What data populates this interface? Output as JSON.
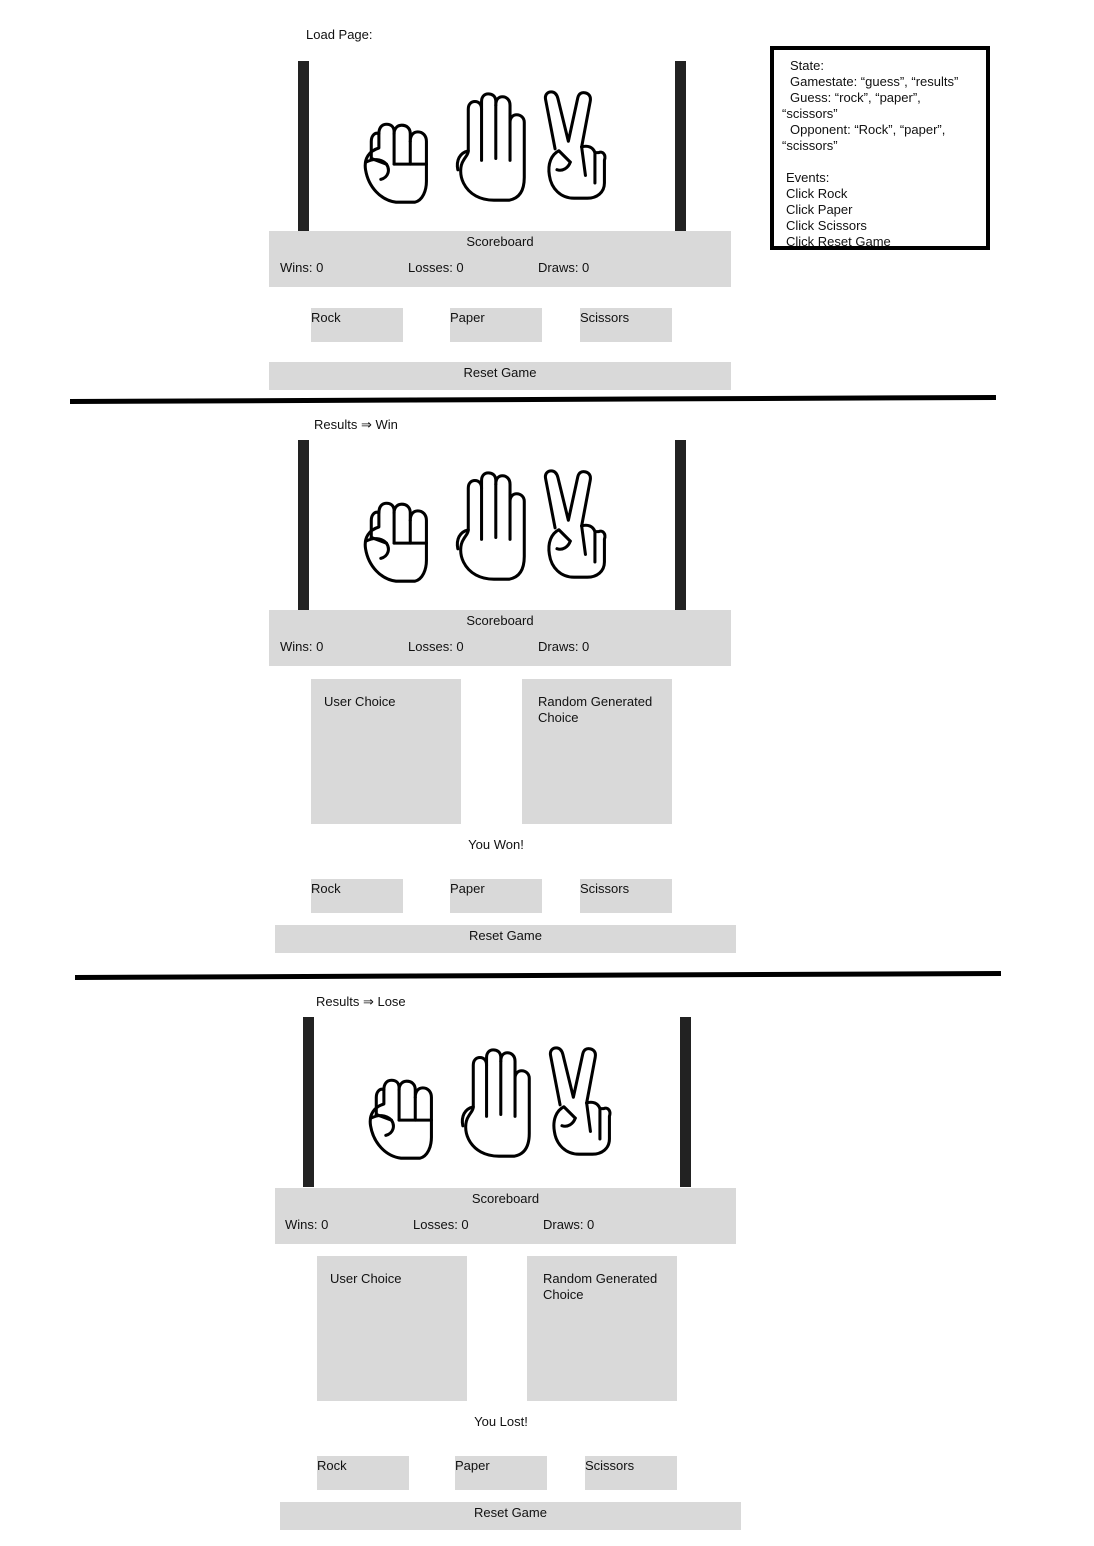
{
  "state_box": {
    "state_label": "State:",
    "gamestate": "Gamestate: “guess”, “results”",
    "guess_line1": "Guess: “rock”, “paper”,",
    "guess_line2": "“scissors”",
    "opponent_line1": "Opponent: “Rock”, “paper”,",
    "opponent_line2": "“scissors”",
    "events_label": "Events:",
    "events": [
      "Click Rock",
      "Click Paper",
      "Click Scissors",
      "Click Reset Game"
    ]
  },
  "sections": [
    {
      "title": "Load Page:",
      "scoreboard": {
        "title": "Scoreboard",
        "wins": "Wins: 0",
        "losses": "Losses: 0",
        "draws": "Draws: 0"
      },
      "buttons": {
        "rock": "Rock",
        "paper": "Paper",
        "scissors": "Scissors"
      },
      "reset": "Reset Game"
    },
    {
      "title": "Results ⇒ Win",
      "scoreboard": {
        "title": "Scoreboard",
        "wins": "Wins: 0",
        "losses": "Losses: 0",
        "draws": "Draws: 0"
      },
      "user_choice": "User Choice",
      "random_choice": "Random Generated Choice",
      "message": "You Won!",
      "buttons": {
        "rock": "Rock",
        "paper": "Paper",
        "scissors": "Scissors"
      },
      "reset": "Reset Game"
    },
    {
      "title": "Results ⇒ Lose",
      "scoreboard": {
        "title": "Scoreboard",
        "wins": "Wins: 0",
        "losses": "Losses: 0",
        "draws": "Draws: 0"
      },
      "user_choice": "User Choice",
      "random_choice": "Random Generated Choice",
      "message": "You Lost!",
      "buttons": {
        "rock": "Rock",
        "paper": "Paper",
        "scissors": "Scissors"
      },
      "reset": "Reset Game"
    }
  ],
  "icons": [
    "rock-hand-icon",
    "paper-hand-icon",
    "scissors-hand-icon"
  ]
}
